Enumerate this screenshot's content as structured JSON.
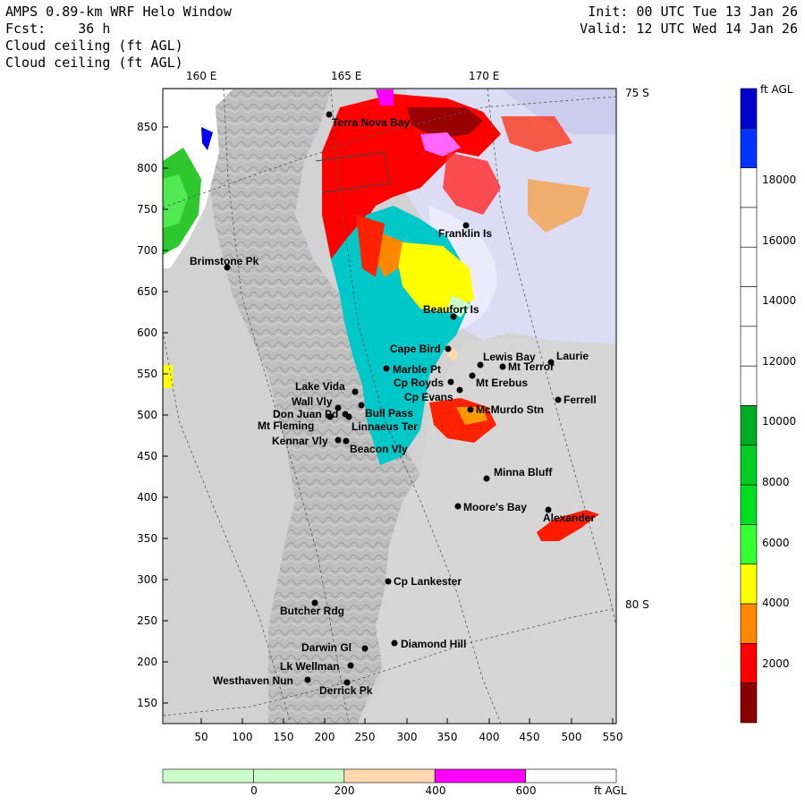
{
  "header": {
    "line1_left": "AMPS 0.89-km WRF Helo Window",
    "line2_left": "Fcst:    36 h",
    "line3_left": "Cloud ceiling (ft AGL)",
    "line4_left": "Cloud ceiling (ft AGL)",
    "line1_right": "Init: 00 UTC Tue 13 Jan 26",
    "line2_right": "Valid: 12 UTC Wed 14 Jan 26"
  },
  "map": {
    "lon_labels": [
      "160 E",
      "165 E",
      "170 E"
    ],
    "lat_labels": [
      "75 S",
      "80 S"
    ],
    "x_ticks": [
      "50",
      "100",
      "150",
      "200",
      "250",
      "300",
      "350",
      "400",
      "450",
      "500",
      "550"
    ],
    "y_ticks": [
      "850",
      "800",
      "750",
      "700",
      "650",
      "600",
      "550",
      "500",
      "450",
      "400",
      "350",
      "300",
      "250",
      "200",
      "150"
    ],
    "places": [
      {
        "name": "Terra Nova Bay"
      },
      {
        "name": "Franklin Is"
      },
      {
        "name": "Brimstone Pk"
      },
      {
        "name": "Beaufort Is"
      },
      {
        "name": "Cape Bird"
      },
      {
        "name": "Lewis Bay"
      },
      {
        "name": "Laurie"
      },
      {
        "name": "Mt Terror"
      },
      {
        "name": "Marble Pt"
      },
      {
        "name": "Cp Royds"
      },
      {
        "name": "Mt Erebus"
      },
      {
        "name": "Lake Vida"
      },
      {
        "name": "Cp Evans"
      },
      {
        "name": "Ferrell"
      },
      {
        "name": "Wall Vly"
      },
      {
        "name": "McMurdo Stn"
      },
      {
        "name": "Don Juan Pd"
      },
      {
        "name": "Bull Pass"
      },
      {
        "name": "Mt Fleming"
      },
      {
        "name": "Linnaeus Ter"
      },
      {
        "name": "Kennar Vly"
      },
      {
        "name": "Beacon Vly"
      },
      {
        "name": "Minna Bluff"
      },
      {
        "name": "Moore's Bay"
      },
      {
        "name": "Alexander"
      },
      {
        "name": "Cp Lankester"
      },
      {
        "name": "Butcher Rdg"
      },
      {
        "name": "Darwin Gl"
      },
      {
        "name": "Diamond Hill"
      },
      {
        "name": "Lk Wellman"
      },
      {
        "name": "Westhaven Nun"
      },
      {
        "name": "Derrick Pk"
      }
    ]
  },
  "colorbar_right": {
    "unit": "ft AGL",
    "labels": [
      "18000",
      "16000",
      "14000",
      "12000",
      "10000",
      "8000",
      "6000",
      "4000",
      "2000"
    ],
    "colors": [
      "#0000cc",
      "#0033ff",
      "#ffffff",
      "#ffffff",
      "#ffffff",
      "#ffffff",
      "#ffffff",
      "#ffffff",
      "#00aa22",
      "#00cc22",
      "#00e020",
      "#33ff33",
      "#ffff00",
      "#ff8800",
      "#ff0000",
      "#880000"
    ]
  },
  "colorbar_bottom": {
    "unit": "ft AGL",
    "labels": [
      "0",
      "200",
      "400",
      "600"
    ],
    "colors": [
      "#ccffcc",
      "#ccffcc",
      "#ffd8b0",
      "#ff00ff",
      "#ffffff"
    ]
  }
}
